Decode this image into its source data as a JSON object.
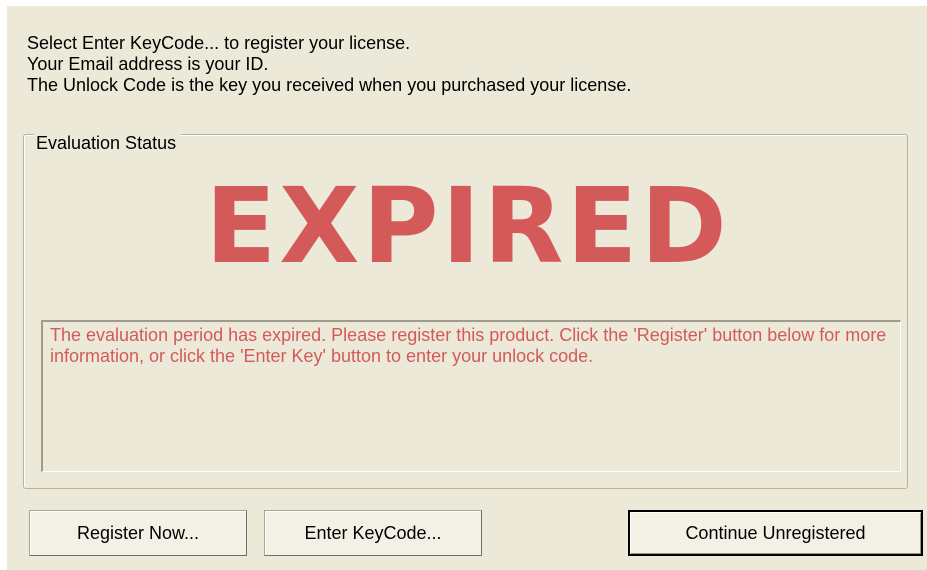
{
  "instructions": {
    "line1": "Select Enter KeyCode... to register your license.",
    "line2": "Your Email address is your ID.",
    "line3": "The Unlock Code is the key you received when you purchased your license."
  },
  "evaluation_status": {
    "legend": "Evaluation Status",
    "status_text": "EXPIRED",
    "status_color": "#d45a5a",
    "message": "The evaluation period has expired. Please register this product. Click the 'Register' button below for more information, or click the 'Enter Key' button to enter your unlock code."
  },
  "buttons": {
    "register": "Register Now...",
    "enter_keycode": "Enter KeyCode...",
    "continue": "Continue Unregistered"
  },
  "colors": {
    "dialog_background": "#ece9d8",
    "accent_red": "#d45a5a"
  }
}
